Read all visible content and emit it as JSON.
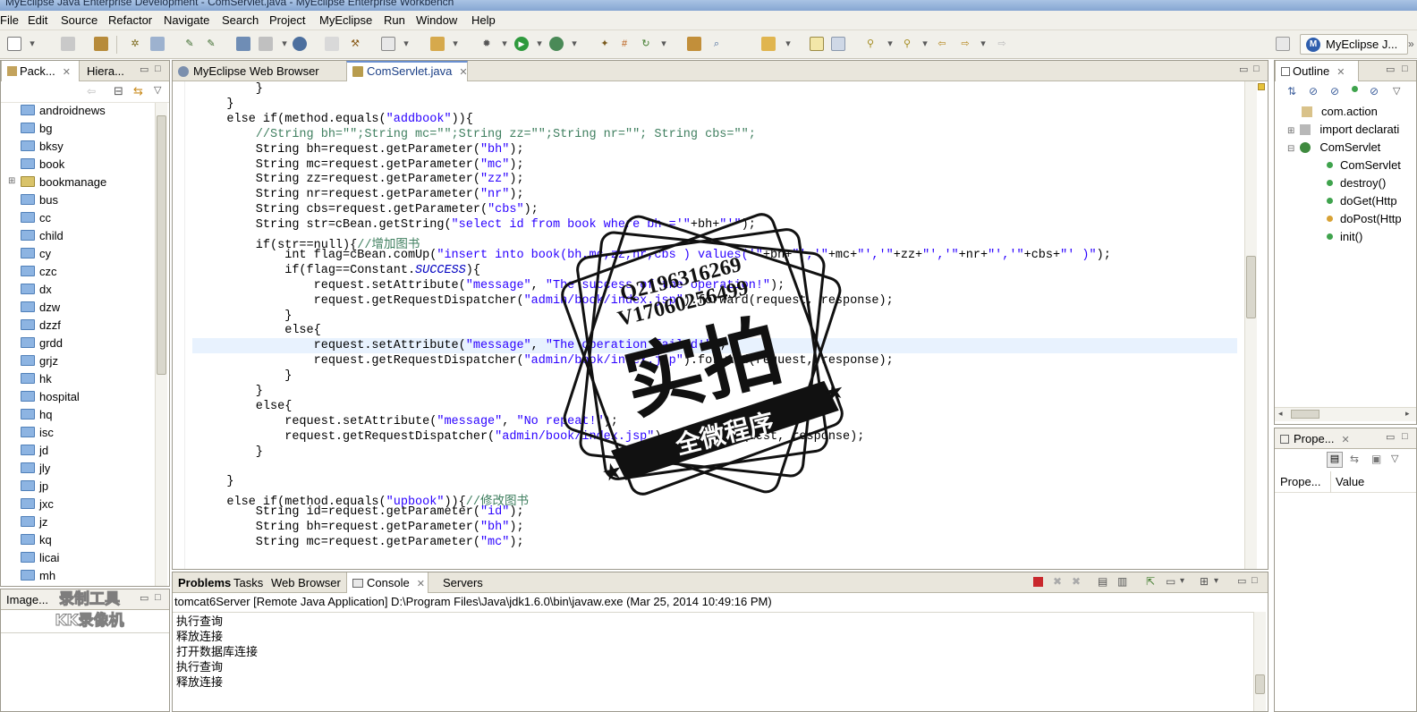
{
  "window": {
    "title": "MyEclipse Java Enterprise Development - ComServlet.java - MyEclipse Enterprise Workbench"
  },
  "menu": [
    "File",
    "Edit",
    "Source",
    "Refactor",
    "Navigate",
    "Search",
    "Project",
    "MyEclipse",
    "Run",
    "Window",
    "Help"
  ],
  "perspective": {
    "label": "MyEclipse J..."
  },
  "left_panel": {
    "tabs": [
      "Pack...",
      "Hiera..."
    ],
    "items": [
      "androidnews",
      "bg",
      "bksy",
      "book",
      "bookmanage",
      "bus",
      "cc",
      "child",
      "cy",
      "czc",
      "dx",
      "dzw",
      "dzzf",
      "grdd",
      "grjz",
      "hk",
      "hospital",
      "hq",
      "isc",
      "jd",
      "jly",
      "jp",
      "jxc",
      "jz",
      "kq",
      "licai",
      "mh"
    ]
  },
  "left_bottom": {
    "tab": "Image..."
  },
  "editor": {
    "tabs": [
      "MyEclipse Web Browser",
      "ComServlet.java"
    ],
    "lines": [
      "        }",
      "    }",
      "    else if(method.equals(\"addbook\")){",
      "        //String bh=\"\";String mc=\"\";String zz=\"\";String nr=\"\"; String cbs=\"\";",
      "        String bh=request.getParameter(\"bh\");",
      "        String mc=request.getParameter(\"mc\");",
      "        String zz=request.getParameter(\"zz\");",
      "        String nr=request.getParameter(\"nr\");",
      "        String cbs=request.getParameter(\"cbs\");",
      "        String str=cBean.getString(\"select id from book where bh ='\"+bh+\"'\");",
      "        if(str==null){//增加图书",
      "            int flag=cBean.comUp(\"insert into book(bh,mc,zz,nr,cbs ) values('\"+bh+\"','\"+mc+\"','\"+zz+\"','\"+nr+\"','\"+cbs+\"' )\");",
      "            if(flag==Constant.SUCCESS){",
      "                request.setAttribute(\"message\", \"The success of the operation!\");",
      "                request.getRequestDispatcher(\"admin/book/index.jsp\").forward(request, response);",
      "            }",
      "            else{",
      "                request.setAttribute(\"message\", \"The operation failed!\");",
      "                request.getRequestDispatcher(\"admin/book/index.jsp\").forward(request, response);",
      "            }",
      "        }",
      "        else{",
      "            request.setAttribute(\"message\", \"No repeat!\");",
      "            request.getRequestDispatcher(\"admin/book/index.jsp\").forward(request, response);",
      "        }",
      "",
      "    }",
      "    else if(method.equals(\"upbook\")){//修改图书",
      "        String id=request.getParameter(\"id\");",
      "        String bh=request.getParameter(\"bh\");",
      "        String mc=request.getParameter(\"mc\");"
    ]
  },
  "bottom_panel": {
    "tabs": [
      "Problems",
      "Tasks",
      "Web Browser",
      "Console",
      "Servers"
    ],
    "console_header": "tomcat6Server [Remote Java Application] D:\\Program Files\\Java\\jdk1.6.0\\bin\\javaw.exe (Mar 25, 2014 10:49:16 PM)",
    "console_lines": [
      "执行查询",
      "释放连接",
      "打开数据库连接",
      "执行查询",
      "释放连接"
    ]
  },
  "outline": {
    "tab": "Outline",
    "items": [
      "com.action",
      "import declarati",
      "ComServlet",
      "ComServlet",
      "destroy()",
      "doGet(Http",
      "doPost(Http",
      "init()"
    ]
  },
  "properties": {
    "tab": "Prope...",
    "col1": "Prope...",
    "col2": "Value"
  },
  "stamp": {
    "top_text": "Q2196316269",
    "second_text": "V17060256499",
    "main_text": "实拍",
    "banner_text": "全微程序"
  },
  "watermark": {
    "line1": "录制工具",
    "line2": "KK录像机"
  }
}
